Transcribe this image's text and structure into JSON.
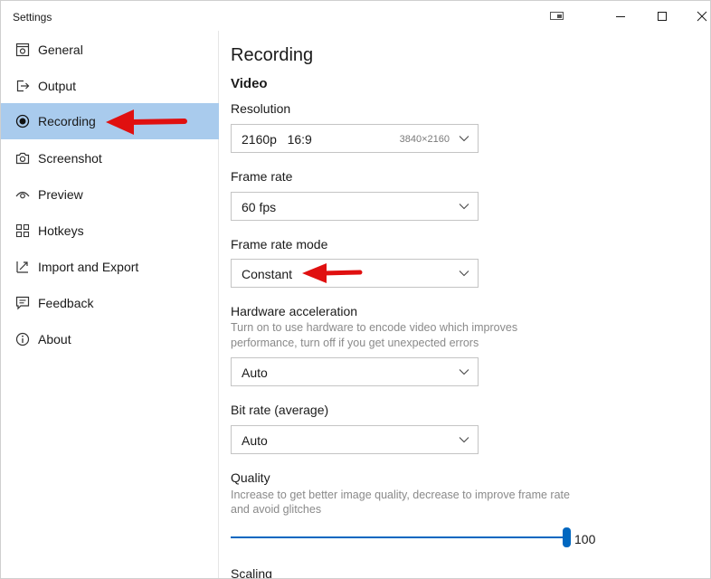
{
  "window": {
    "title": "Settings"
  },
  "sidebar": {
    "items": [
      {
        "label": "General",
        "icon": "general-icon"
      },
      {
        "label": "Output",
        "icon": "output-icon"
      },
      {
        "label": "Recording",
        "icon": "record-icon",
        "active": true
      },
      {
        "label": "Screenshot",
        "icon": "camera-icon"
      },
      {
        "label": "Preview",
        "icon": "eye-icon"
      },
      {
        "label": "Hotkeys",
        "icon": "keyboard-icon"
      },
      {
        "label": "Import and Export",
        "icon": "import-export-icon"
      },
      {
        "label": "Feedback",
        "icon": "feedback-icon"
      },
      {
        "label": "About",
        "icon": "info-icon"
      }
    ]
  },
  "main": {
    "title": "Recording",
    "section": "Video",
    "resolution": {
      "label": "Resolution",
      "value": "2160p   16:9",
      "detail": "3840×2160"
    },
    "frame_rate": {
      "label": "Frame rate",
      "value": "60 fps"
    },
    "frame_rate_mode": {
      "label": "Frame rate mode",
      "value": "Constant"
    },
    "hardware_acceleration": {
      "label": "Hardware acceleration",
      "help_line1": "Turn on to use hardware to encode video which improves",
      "help_line2": "performance, turn off if you get unexpected errors",
      "value": "Auto"
    },
    "bit_rate": {
      "label": "Bit rate (average)",
      "value": "Auto"
    },
    "quality": {
      "label": "Quality",
      "help_line1": "Increase to get better image quality, decrease to improve frame rate",
      "help_line2": "and avoid glitches",
      "value": 100,
      "display": "100"
    },
    "next_section_partial": "Scaling"
  },
  "colors": {
    "active_nav": "#a9cbed",
    "accent": "#0067c0",
    "annotation_arrow": "#e01010"
  }
}
